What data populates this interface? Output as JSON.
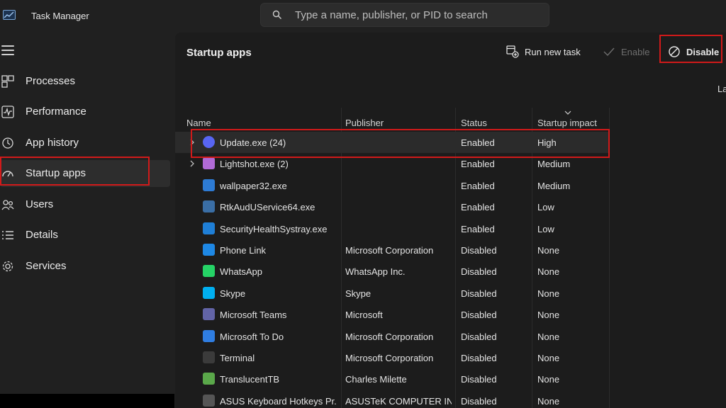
{
  "window": {
    "title": "Task Manager"
  },
  "search": {
    "placeholder": "Type a name, publisher, or PID to search"
  },
  "sidebar": {
    "items": [
      {
        "label": "Processes",
        "icon": "processes-icon"
      },
      {
        "label": "Performance",
        "icon": "performance-icon"
      },
      {
        "label": "App history",
        "icon": "app-history-icon"
      },
      {
        "label": "Startup apps",
        "icon": "startup-apps-icon",
        "active": true
      },
      {
        "label": "Users",
        "icon": "users-icon"
      },
      {
        "label": "Details",
        "icon": "details-icon"
      },
      {
        "label": "Services",
        "icon": "services-icon"
      }
    ]
  },
  "main": {
    "title": "Startup apps",
    "toolbar": {
      "run_new_task": "Run new task",
      "enable": "Enable",
      "disable": "Disable"
    },
    "last_bios_label": "La",
    "columns": {
      "name": "Name",
      "publisher": "Publisher",
      "status": "Status",
      "impact": "Startup impact"
    },
    "rows": [
      {
        "name": "Update.exe (24)",
        "publisher": "",
        "status": "Enabled",
        "impact": "High",
        "expandable": true,
        "icon_color": "#5865f2"
      },
      {
        "name": "Lightshot.exe (2)",
        "publisher": "",
        "status": "Enabled",
        "impact": "Medium",
        "expandable": true,
        "icon_color": "#b06ad6"
      },
      {
        "name": "wallpaper32.exe",
        "publisher": "",
        "status": "Enabled",
        "impact": "Medium",
        "icon_color": "#2d7bd4"
      },
      {
        "name": "RtkAudUService64.exe",
        "publisher": "",
        "status": "Enabled",
        "impact": "Low",
        "icon_color": "#3a6ea5"
      },
      {
        "name": "SecurityHealthSystray.exe",
        "publisher": "",
        "status": "Enabled",
        "impact": "Low",
        "icon_color": "#1f7fd6"
      },
      {
        "name": "Phone Link",
        "publisher": "Microsoft Corporation",
        "status": "Disabled",
        "impact": "None",
        "icon_color": "#1e88e5"
      },
      {
        "name": "WhatsApp",
        "publisher": "WhatsApp Inc.",
        "status": "Disabled",
        "impact": "None",
        "icon_color": "#25d366"
      },
      {
        "name": "Skype",
        "publisher": "Skype",
        "status": "Disabled",
        "impact": "None",
        "icon_color": "#00aff0"
      },
      {
        "name": "Microsoft Teams",
        "publisher": "Microsoft",
        "status": "Disabled",
        "impact": "None",
        "icon_color": "#6264a7"
      },
      {
        "name": "Microsoft To Do",
        "publisher": "Microsoft Corporation",
        "status": "Disabled",
        "impact": "None",
        "icon_color": "#2f7de1"
      },
      {
        "name": "Terminal",
        "publisher": "Microsoft Corporation",
        "status": "Disabled",
        "impact": "None",
        "icon_color": "#3b3b3b"
      },
      {
        "name": "TranslucentTB",
        "publisher": "Charles Milette",
        "status": "Disabled",
        "impact": "None",
        "icon_color": "#5aa84a"
      },
      {
        "name": "ASUS Keyboard Hotkeys Pr...",
        "publisher": "ASUSTeK COMPUTER INC.",
        "status": "Disabled",
        "impact": "None",
        "icon_color": "#555555"
      }
    ]
  },
  "colors": {
    "highlight": "#d11a1a",
    "background": "#202020"
  }
}
